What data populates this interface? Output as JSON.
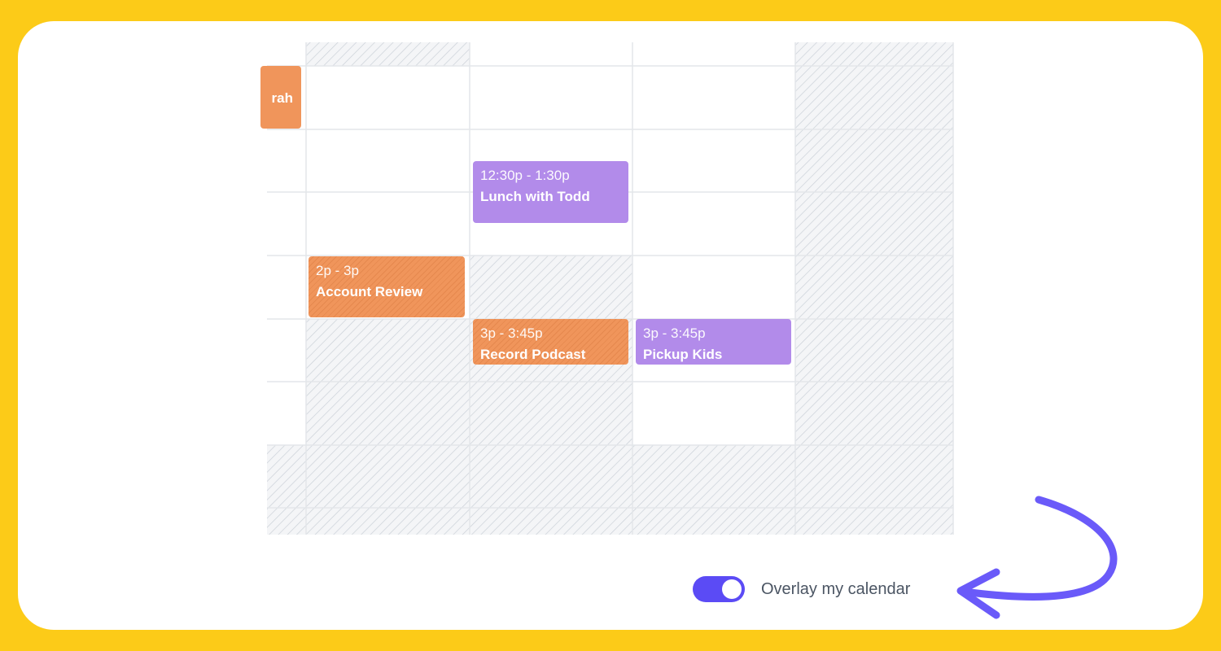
{
  "calendar": {
    "events": [
      {
        "time": "",
        "title": "rah",
        "color": "#F0955B"
      },
      {
        "time": "12:30p - 1:30p",
        "title": "Lunch with Todd",
        "color": "#B28BEA"
      },
      {
        "time": "2p - 3p",
        "title": "Account Review",
        "color": "#F0955B"
      },
      {
        "time": "3p - 3:45p",
        "title": "Record Podcast",
        "color": "#F0955B"
      },
      {
        "time": "3p - 3:45p",
        "title": "Pickup Kids",
        "color": "#B28BEA"
      }
    ]
  },
  "overlay_toggle": {
    "label": "Overlay my calendar",
    "on": true,
    "accent": "#5B4BF5"
  },
  "annotation": {
    "arrow_color": "#6A5AF9"
  },
  "colors": {
    "background": "#FCCB18",
    "card": "#FFFFFF",
    "grid_line": "#E3E6EA",
    "hatch": "#D5DAE0"
  }
}
